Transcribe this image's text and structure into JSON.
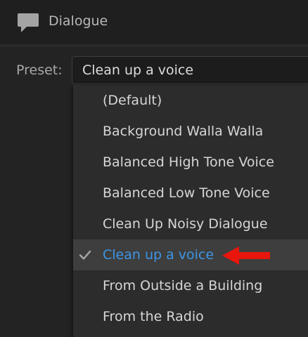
{
  "panel": {
    "title": "Dialogue",
    "icon": "speech-bubble-icon"
  },
  "preset": {
    "label": "Preset:",
    "value": "Clean up a voice"
  },
  "menu": {
    "items": [
      {
        "label": "(Default)",
        "selected": false
      },
      {
        "label": "Background Walla Walla",
        "selected": false
      },
      {
        "label": "Balanced High Tone Voice",
        "selected": false
      },
      {
        "label": "Balanced Low Tone Voice",
        "selected": false
      },
      {
        "label": "Clean Up Noisy Dialogue",
        "selected": false
      },
      {
        "label": "Clean up a voice",
        "selected": true
      },
      {
        "label": "From Outside a Building",
        "selected": false
      },
      {
        "label": "From the Radio",
        "selected": false
      }
    ]
  },
  "colors": {
    "background": "#232323",
    "menu_background": "#2c2c2c",
    "selected_row": "#3e3e3e",
    "selected_text": "#3d95e4",
    "annotation_arrow": "#e8160c"
  }
}
